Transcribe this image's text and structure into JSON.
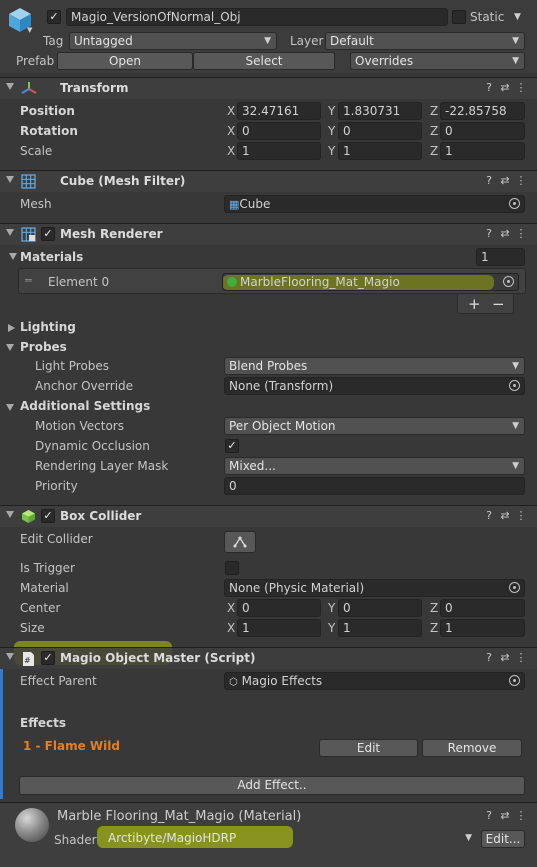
{
  "object": {
    "name": "Magio_VersionOfNormal_Obj",
    "static_label": "Static",
    "tag_label": "Tag",
    "tag_value": "Untagged",
    "layer_label": "Layer",
    "layer_value": "Default",
    "prefab_label": "Prefab",
    "open_label": "Open",
    "select_label": "Select",
    "overrides_label": "Overrides"
  },
  "transform": {
    "title": "Transform",
    "position_label": "Position",
    "rotation_label": "Rotation",
    "scale_label": "Scale",
    "position": {
      "x": "32.47161",
      "y": "1.830731",
      "z": "-22.85758"
    },
    "rotation": {
      "x": "0",
      "y": "0",
      "z": "0"
    },
    "scale": {
      "x": "1",
      "y": "1",
      "z": "1"
    }
  },
  "axes": {
    "x": "X",
    "y": "Y",
    "z": "Z"
  },
  "mesh_filter": {
    "title": "Cube (Mesh Filter)",
    "mesh_label": "Mesh",
    "mesh_value": "Cube"
  },
  "mesh_renderer": {
    "title": "Mesh Renderer",
    "materials_label": "Materials",
    "materials_count": "1",
    "element_label": "Element 0",
    "element_value": "MarbleFlooring_Mat_Magio",
    "plus": "+",
    "minus": "−",
    "lighting_label": "Lighting",
    "probes_label": "Probes",
    "light_probes_label": "Light Probes",
    "light_probes_value": "Blend Probes",
    "anchor_label": "Anchor Override",
    "anchor_value": "None (Transform)",
    "additional_label": "Additional Settings",
    "motion_label": "Motion Vectors",
    "motion_value": "Per Object Motion",
    "dynamic_label": "Dynamic Occlusion",
    "rendering_label": "Rendering Layer Mask",
    "rendering_value": "Mixed...",
    "priority_label": "Priority",
    "priority_value": "0"
  },
  "box_collider": {
    "title": "Box Collider",
    "edit_label": "Edit Collider",
    "trigger_label": "Is Trigger",
    "material_label": "Material",
    "material_value": "None (Physic Material)",
    "center_label": "Center",
    "size_label": "Size",
    "center": {
      "x": "0",
      "y": "0",
      "z": "0"
    },
    "size": {
      "x": "1",
      "y": "1",
      "z": "1"
    }
  },
  "script": {
    "title": "Magio Object Master (Script)",
    "parent_label": "Effect Parent",
    "parent_value": "Magio Effects",
    "effects_label": "Effects",
    "effect_item": "1 - Flame Wild",
    "edit_label": "Edit",
    "remove_label": "Remove",
    "add_label": "Add Effect.."
  },
  "material": {
    "title": "Marble Flooring_Mat_Magio (Material)",
    "shader_label": "Shader",
    "shader_value": "Arctibyte/MagioHDRP",
    "edit_label": "Edit..."
  },
  "icons": {
    "help": "?",
    "settings": "⇄",
    "menu": "⋮",
    "check": "✓",
    "arrow": "▼"
  },
  "colors": {
    "accent_orange": "#e0802a",
    "highlight": "#d2e600",
    "script_bar": "#3a79c8"
  }
}
